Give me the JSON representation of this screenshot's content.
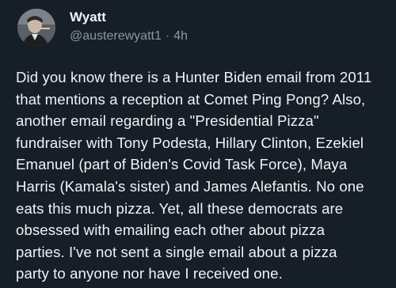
{
  "author": {
    "display_name": "Wyatt",
    "handle": "@austerewyatt1",
    "separator": "·",
    "time": "4h"
  },
  "post": {
    "lines": [
      "Did you know there is a Hunter Biden email from 2011",
      "that mentions a reception at Comet Ping Pong? Also,",
      "another email regarding a \"Presidential Pizza\"",
      "fundraiser with Tony Podesta, Hillary Clinton, Ezekiel",
      "Emanuel (part of Biden's Covid Task Force), Maya",
      "Harris (Kamala's sister) and James Alefantis. No one",
      "eats this much pizza. Yet, all these democrats are",
      "obsessed with emailing each other about pizza",
      "parties. I've not sent a single email about a pizza",
      "party to anyone nor have I received one."
    ]
  },
  "colors": {
    "background": "#161e27",
    "text": "#f1f3f5",
    "muted": "#8b98a5"
  }
}
